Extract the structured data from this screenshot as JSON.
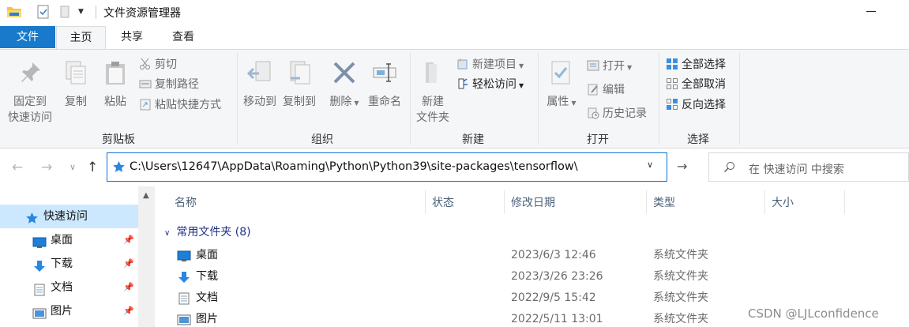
{
  "window": {
    "title": "文件资源管理器",
    "quick_access_toolbar": [
      "folder-icon",
      "properties-check-icon",
      "new-folder-icon",
      "customize-dropdown-icon"
    ]
  },
  "ribbon_tabs": {
    "file": "文件",
    "home": "主页",
    "share": "共享",
    "view": "查看"
  },
  "ribbon": {
    "clipboard": {
      "label": "剪贴板",
      "pin_line1": "固定到",
      "pin_line2": "快速访问",
      "copy": "复制",
      "paste": "粘贴",
      "cut": "剪切",
      "copy_path": "复制路径",
      "paste_shortcut": "粘贴快捷方式"
    },
    "organize": {
      "label": "组织",
      "move_to": "移动到",
      "copy_to": "复制到",
      "delete": "删除",
      "rename": "重命名"
    },
    "new": {
      "label": "新建",
      "new_folder_line1": "新建",
      "new_folder_line2": "文件夹",
      "new_item": "新建项目",
      "easy_access": "轻松访问"
    },
    "open": {
      "label": "打开",
      "properties": "属性",
      "open": "打开",
      "edit": "编辑",
      "history": "历史记录"
    },
    "select": {
      "label": "选择",
      "select_all": "全部选择",
      "select_none": "全部取消",
      "invert": "反向选择"
    }
  },
  "address": {
    "path": "C:\\Users\\12647\\AppData\\Roaming\\Python\\Python39\\site-packages\\tensorflow\\",
    "search_placeholder": "在 快速访问 中搜索"
  },
  "nav_pane": {
    "items": [
      {
        "label": "快速访问",
        "icon": "star-icon",
        "selected": true
      },
      {
        "label": "桌面",
        "icon": "desktop-icon",
        "pinned": true
      },
      {
        "label": "下载",
        "icon": "download-icon",
        "pinned": true
      },
      {
        "label": "文档",
        "icon": "document-icon",
        "pinned": true
      },
      {
        "label": "图片",
        "icon": "picture-icon",
        "pinned": true
      }
    ]
  },
  "content": {
    "columns": {
      "name": "名称",
      "status": "状态",
      "date": "修改日期",
      "type": "类型",
      "size": "大小"
    },
    "group_header": "常用文件夹 (8)",
    "rows": [
      {
        "name": "桌面",
        "icon": "desktop-icon",
        "date": "2023/6/3 12:46",
        "type": "系统文件夹"
      },
      {
        "name": "下载",
        "icon": "download-icon",
        "date": "2023/3/26 23:26",
        "type": "系统文件夹"
      },
      {
        "name": "文档",
        "icon": "document-icon",
        "date": "2022/9/5 15:42",
        "type": "系统文件夹"
      },
      {
        "name": "图片",
        "icon": "picture-icon",
        "date": "2022/5/11 13:01",
        "type": "系统文件夹"
      }
    ]
  },
  "watermark": "CSDN @LJLconfidence",
  "colors": {
    "file_tab": "#1979ca",
    "ribbon_bg": "#f5f6f7",
    "selection": "#cce8ff",
    "address_border": "#0a72d8",
    "group_header": "#1e3287"
  }
}
